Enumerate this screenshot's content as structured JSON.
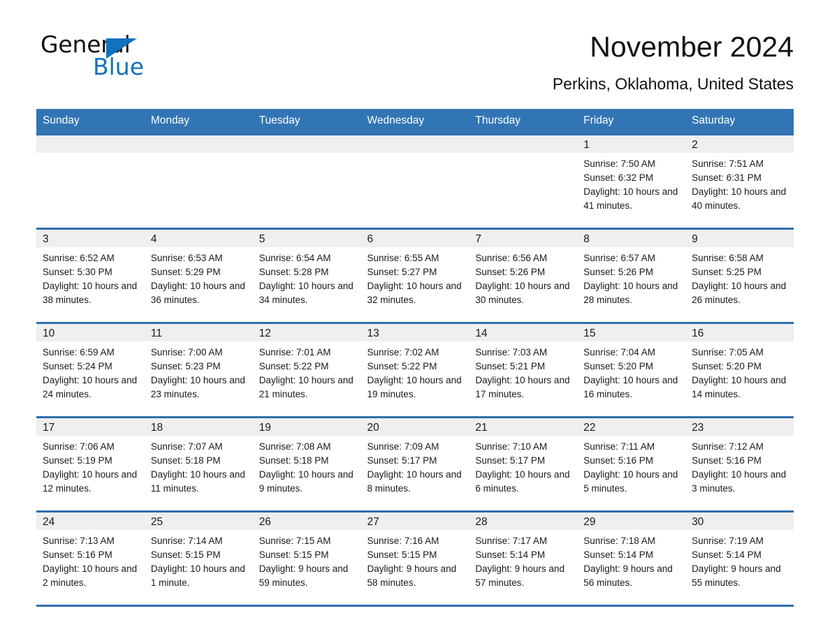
{
  "brand": {
    "name_dark": "General",
    "name_light": "Blue",
    "triangle_color": "#1271BE",
    "logo_icon": "blue-triangle-icon"
  },
  "header": {
    "title": "November 2024",
    "location": "Perkins, Oklahoma, United States"
  },
  "theme": {
    "header_blue": "#3275B5",
    "row_border_blue": "#2E6FAC",
    "daynum_band_gray": "#efefef",
    "text": "#1a1a1a"
  },
  "calendar": {
    "weekday_headers": [
      "Sunday",
      "Monday",
      "Tuesday",
      "Wednesday",
      "Thursday",
      "Friday",
      "Saturday"
    ],
    "labels": {
      "sunrise_prefix": "Sunrise:",
      "sunset_prefix": "Sunset:",
      "daylight_prefix": "Daylight:"
    },
    "weeks": [
      [
        {
          "day": "",
          "empty": true
        },
        {
          "day": "",
          "empty": true
        },
        {
          "day": "",
          "empty": true
        },
        {
          "day": "",
          "empty": true
        },
        {
          "day": "",
          "empty": true
        },
        {
          "day": "1",
          "sunrise": "Sunrise: 7:50 AM",
          "sunset": "Sunset: 6:32 PM",
          "daylight": "Daylight: 10 hours and 41 minutes."
        },
        {
          "day": "2",
          "sunrise": "Sunrise: 7:51 AM",
          "sunset": "Sunset: 6:31 PM",
          "daylight": "Daylight: 10 hours and 40 minutes."
        }
      ],
      [
        {
          "day": "3",
          "sunrise": "Sunrise: 6:52 AM",
          "sunset": "Sunset: 5:30 PM",
          "daylight": "Daylight: 10 hours and 38 minutes."
        },
        {
          "day": "4",
          "sunrise": "Sunrise: 6:53 AM",
          "sunset": "Sunset: 5:29 PM",
          "daylight": "Daylight: 10 hours and 36 minutes."
        },
        {
          "day": "5",
          "sunrise": "Sunrise: 6:54 AM",
          "sunset": "Sunset: 5:28 PM",
          "daylight": "Daylight: 10 hours and 34 minutes."
        },
        {
          "day": "6",
          "sunrise": "Sunrise: 6:55 AM",
          "sunset": "Sunset: 5:27 PM",
          "daylight": "Daylight: 10 hours and 32 minutes."
        },
        {
          "day": "7",
          "sunrise": "Sunrise: 6:56 AM",
          "sunset": "Sunset: 5:26 PM",
          "daylight": "Daylight: 10 hours and 30 minutes."
        },
        {
          "day": "8",
          "sunrise": "Sunrise: 6:57 AM",
          "sunset": "Sunset: 5:26 PM",
          "daylight": "Daylight: 10 hours and 28 minutes."
        },
        {
          "day": "9",
          "sunrise": "Sunrise: 6:58 AM",
          "sunset": "Sunset: 5:25 PM",
          "daylight": "Daylight: 10 hours and 26 minutes."
        }
      ],
      [
        {
          "day": "10",
          "sunrise": "Sunrise: 6:59 AM",
          "sunset": "Sunset: 5:24 PM",
          "daylight": "Daylight: 10 hours and 24 minutes."
        },
        {
          "day": "11",
          "sunrise": "Sunrise: 7:00 AM",
          "sunset": "Sunset: 5:23 PM",
          "daylight": "Daylight: 10 hours and 23 minutes."
        },
        {
          "day": "12",
          "sunrise": "Sunrise: 7:01 AM",
          "sunset": "Sunset: 5:22 PM",
          "daylight": "Daylight: 10 hours and 21 minutes."
        },
        {
          "day": "13",
          "sunrise": "Sunrise: 7:02 AM",
          "sunset": "Sunset: 5:22 PM",
          "daylight": "Daylight: 10 hours and 19 minutes."
        },
        {
          "day": "14",
          "sunrise": "Sunrise: 7:03 AM",
          "sunset": "Sunset: 5:21 PM",
          "daylight": "Daylight: 10 hours and 17 minutes."
        },
        {
          "day": "15",
          "sunrise": "Sunrise: 7:04 AM",
          "sunset": "Sunset: 5:20 PM",
          "daylight": "Daylight: 10 hours and 16 minutes."
        },
        {
          "day": "16",
          "sunrise": "Sunrise: 7:05 AM",
          "sunset": "Sunset: 5:20 PM",
          "daylight": "Daylight: 10 hours and 14 minutes."
        }
      ],
      [
        {
          "day": "17",
          "sunrise": "Sunrise: 7:06 AM",
          "sunset": "Sunset: 5:19 PM",
          "daylight": "Daylight: 10 hours and 12 minutes."
        },
        {
          "day": "18",
          "sunrise": "Sunrise: 7:07 AM",
          "sunset": "Sunset: 5:18 PM",
          "daylight": "Daylight: 10 hours and 11 minutes."
        },
        {
          "day": "19",
          "sunrise": "Sunrise: 7:08 AM",
          "sunset": "Sunset: 5:18 PM",
          "daylight": "Daylight: 10 hours and 9 minutes."
        },
        {
          "day": "20",
          "sunrise": "Sunrise: 7:09 AM",
          "sunset": "Sunset: 5:17 PM",
          "daylight": "Daylight: 10 hours and 8 minutes."
        },
        {
          "day": "21",
          "sunrise": "Sunrise: 7:10 AM",
          "sunset": "Sunset: 5:17 PM",
          "daylight": "Daylight: 10 hours and 6 minutes."
        },
        {
          "day": "22",
          "sunrise": "Sunrise: 7:11 AM",
          "sunset": "Sunset: 5:16 PM",
          "daylight": "Daylight: 10 hours and 5 minutes."
        },
        {
          "day": "23",
          "sunrise": "Sunrise: 7:12 AM",
          "sunset": "Sunset: 5:16 PM",
          "daylight": "Daylight: 10 hours and 3 minutes."
        }
      ],
      [
        {
          "day": "24",
          "sunrise": "Sunrise: 7:13 AM",
          "sunset": "Sunset: 5:16 PM",
          "daylight": "Daylight: 10 hours and 2 minutes."
        },
        {
          "day": "25",
          "sunrise": "Sunrise: 7:14 AM",
          "sunset": "Sunset: 5:15 PM",
          "daylight": "Daylight: 10 hours and 1 minute."
        },
        {
          "day": "26",
          "sunrise": "Sunrise: 7:15 AM",
          "sunset": "Sunset: 5:15 PM",
          "daylight": "Daylight: 9 hours and 59 minutes."
        },
        {
          "day": "27",
          "sunrise": "Sunrise: 7:16 AM",
          "sunset": "Sunset: 5:15 PM",
          "daylight": "Daylight: 9 hours and 58 minutes."
        },
        {
          "day": "28",
          "sunrise": "Sunrise: 7:17 AM",
          "sunset": "Sunset: 5:14 PM",
          "daylight": "Daylight: 9 hours and 57 minutes."
        },
        {
          "day": "29",
          "sunrise": "Sunrise: 7:18 AM",
          "sunset": "Sunset: 5:14 PM",
          "daylight": "Daylight: 9 hours and 56 minutes."
        },
        {
          "day": "30",
          "sunrise": "Sunrise: 7:19 AM",
          "sunset": "Sunset: 5:14 PM",
          "daylight": "Daylight: 9 hours and 55 minutes."
        }
      ]
    ]
  }
}
